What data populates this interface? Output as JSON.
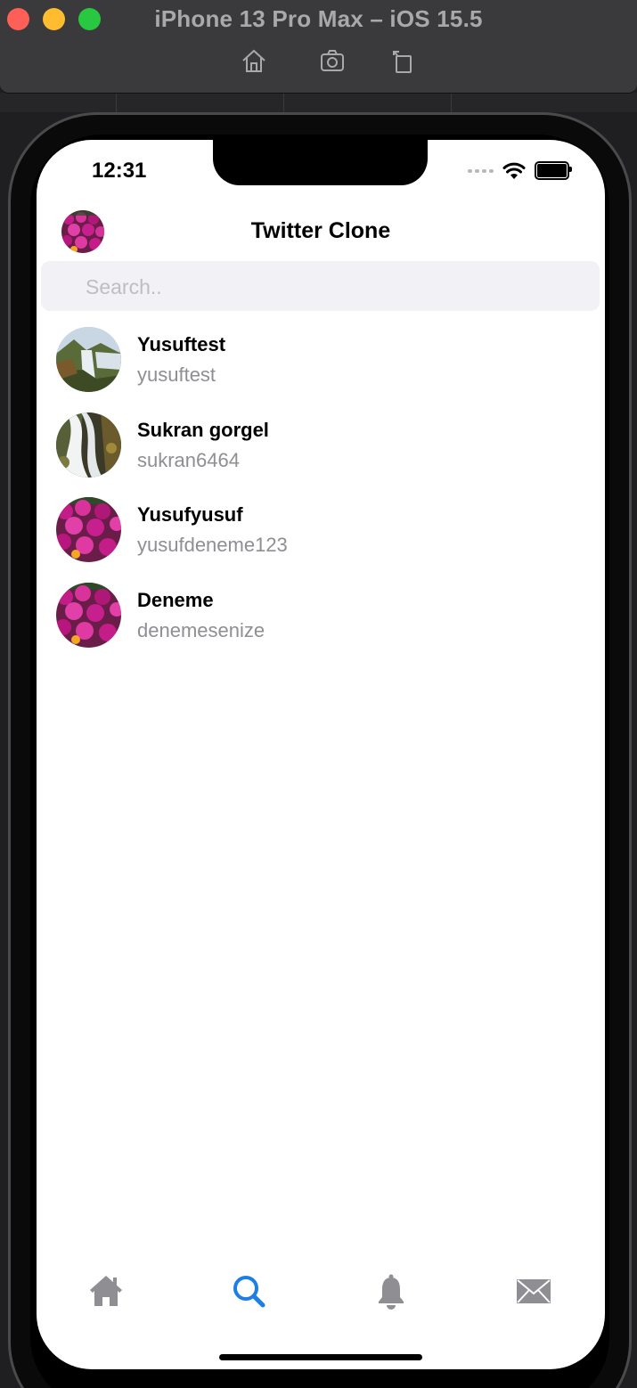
{
  "window": {
    "title": "iPhone 13 Pro Max – iOS 15.5",
    "toolbar": [
      "home-icon",
      "screenshot-icon",
      "rotate-icon"
    ]
  },
  "status_bar": {
    "time": "12:31"
  },
  "header": {
    "title": "Twitter Clone"
  },
  "search": {
    "placeholder": "Search..",
    "value": ""
  },
  "users": [
    {
      "name": "Yusuftest",
      "handle": "yusuftest",
      "avatar": "waterfall-landscape"
    },
    {
      "name": "Sukran gorgel",
      "handle": "sukran6464",
      "avatar": "waterfall-long-exposure"
    },
    {
      "name": "Yusufyusuf",
      "handle": "yusufdeneme123",
      "avatar": "pink-flowers"
    },
    {
      "name": "Deneme",
      "handle": "denemesenize",
      "avatar": "pink-flowers"
    }
  ],
  "tab_bar": {
    "items": [
      "home-icon",
      "search-icon",
      "bell-icon",
      "envelope-icon"
    ],
    "active": "search-icon",
    "active_color": "#1d7fe3",
    "inactive_color": "#8e8e93"
  }
}
